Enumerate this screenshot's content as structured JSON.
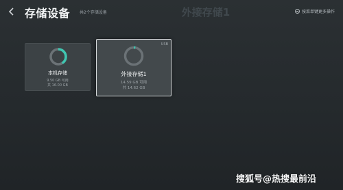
{
  "header": {
    "back_icon": "chevron-left-icon",
    "title": "存储设备",
    "subtitle": "共2个存储设备",
    "center_title": "外接存储1",
    "right_action": {
      "icon": "settings-circle-icon",
      "label": "按菜单键更多操作"
    }
  },
  "devices": [
    {
      "name": "本机存储",
      "free": "9.50 GB 可用",
      "total": "共 16.00 GB",
      "used_fraction": 0.41,
      "ring_color": "#3fc6b1",
      "focused": false
    },
    {
      "name": "外接存储1",
      "free": "14.59 GB 可用",
      "total": "共 14.62 GB",
      "tag": "USB",
      "used_fraction": 0.03,
      "ring_color": "#3fc6b1",
      "focused": true
    }
  ],
  "watermark": "搜狐号@热搜最前沿",
  "colors": {
    "accent": "#3fc6b1",
    "ring_track": "#6b7276",
    "focus_border": "#d9dcde"
  }
}
